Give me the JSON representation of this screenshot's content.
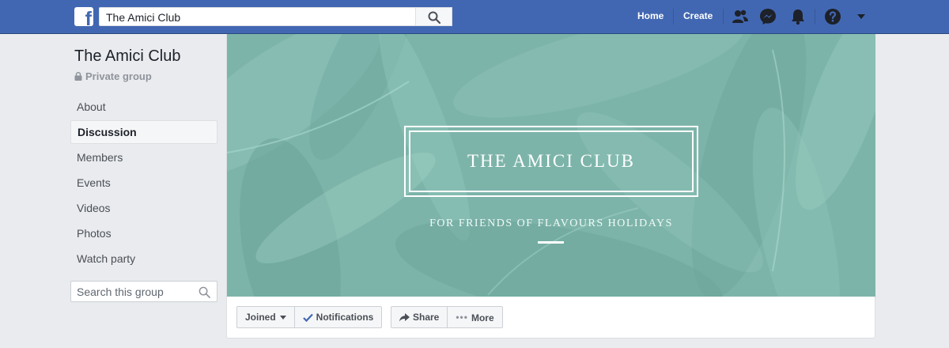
{
  "topbar": {
    "logo": "f",
    "search_value": "The Amici Club",
    "home_label": "Home",
    "create_label": "Create",
    "icons": [
      "friends-icon",
      "messenger-icon",
      "bell-icon",
      "help-icon",
      "chevron-down-icon"
    ]
  },
  "group": {
    "name": "The Amici Club",
    "privacy": "Private group"
  },
  "sidebar": {
    "items": [
      {
        "label": "About",
        "active": false
      },
      {
        "label": "Discussion",
        "active": true
      },
      {
        "label": "Members",
        "active": false
      },
      {
        "label": "Events",
        "active": false
      },
      {
        "label": "Videos",
        "active": false
      },
      {
        "label": "Photos",
        "active": false
      },
      {
        "label": "Watch party",
        "active": false
      }
    ],
    "search_placeholder": "Search this group"
  },
  "cover": {
    "title": "THE AMICI CLUB",
    "subtitle": "FOR FRIENDS OF FLAVOURS HOLIDAYS",
    "bg_color": "#7fb7ad"
  },
  "actions": {
    "joined_label": "Joined",
    "notifications_label": "Notifications",
    "share_label": "Share",
    "more_label": "More"
  },
  "colors": {
    "brand": "#4267b2",
    "check": "#4267b2"
  }
}
